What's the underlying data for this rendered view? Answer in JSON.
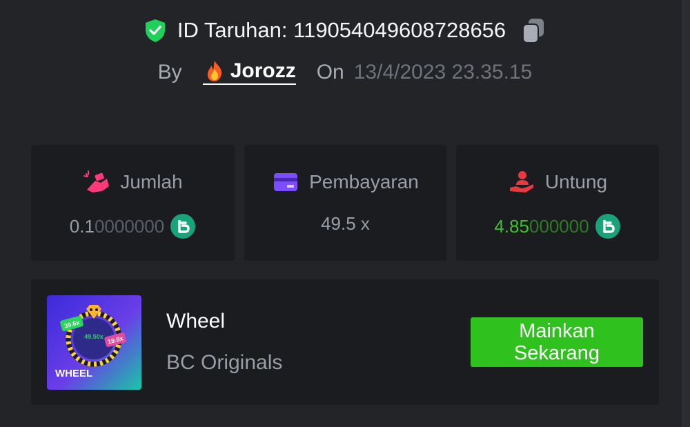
{
  "header": {
    "bet_id_label": "ID Taruhan: 119054049608728656",
    "by_label": "By",
    "username": "Jorozz",
    "on_label": "On",
    "date": "13/4/2023 23.35.15"
  },
  "stats": [
    {
      "label": "Jumlah",
      "value_main": "0.1",
      "value_trail": "0000000",
      "icon": "bet-hand-icon",
      "color": "#ff3a7a"
    },
    {
      "label": "Pembayaran",
      "value_main": "49.5 x",
      "value_trail": "",
      "icon": "card-icon",
      "color": "#7c4cff"
    },
    {
      "label": "Untung",
      "value_main": "4.85",
      "value_trail": "000000",
      "icon": "profit-hand-icon",
      "color": "#e8393e"
    }
  ],
  "game": {
    "name": "Wheel",
    "provider": "BC Originals",
    "play_label": "Mainkan Sekarang",
    "thumb_title": "WHEEL",
    "thumb_tags": [
      "39.6x",
      "49.50x",
      "19.8x"
    ]
  },
  "colors": {
    "accent_green": "#2fc11e",
    "profit_green": "#3fc02b",
    "coin_teal": "#1aa37a",
    "shield_green": "#1fd15a"
  }
}
